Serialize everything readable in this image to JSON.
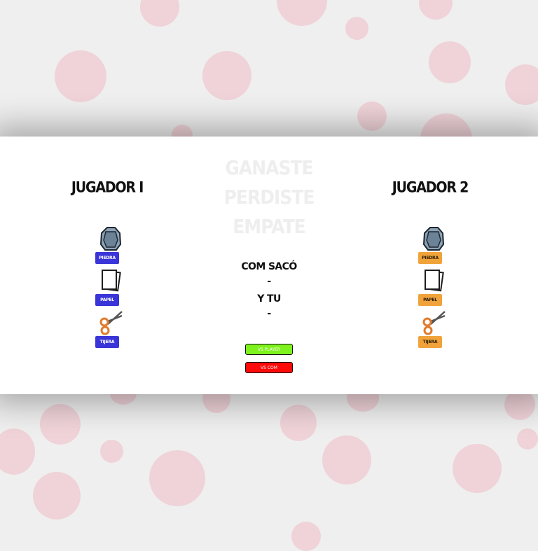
{
  "player1": {
    "title": "JUGADOR I",
    "choices": [
      {
        "label": "PIEDRA",
        "icon": "rock-icon"
      },
      {
        "label": "PAPEL",
        "icon": "paper-icon"
      },
      {
        "label": "TIJERA",
        "icon": "scissors-icon"
      }
    ],
    "button_color": "#3a35d8"
  },
  "player2": {
    "title": "JUGADOR 2",
    "choices": [
      {
        "label": "PIEDRA",
        "icon": "rock-icon"
      },
      {
        "label": "PAPEL",
        "icon": "paper-icon"
      },
      {
        "label": "TIJERA",
        "icon": "scissors-icon"
      }
    ],
    "button_color": "#f0a33a"
  },
  "results": {
    "win": "GANASTE",
    "lose": "PERDISTE",
    "draw": "EMPATE"
  },
  "status": {
    "com_label": "COM SACÓ",
    "com_value": "-",
    "you_label": "Y TU",
    "you_value": "-"
  },
  "modes": {
    "vs_player": "VS PLAYER",
    "vs_com": "VS COM",
    "vs_player_color": "#7df21c",
    "vs_com_color": "#ff0a0a"
  },
  "background": {
    "color": "#efefef",
    "dot_color": "#efd3d8"
  }
}
